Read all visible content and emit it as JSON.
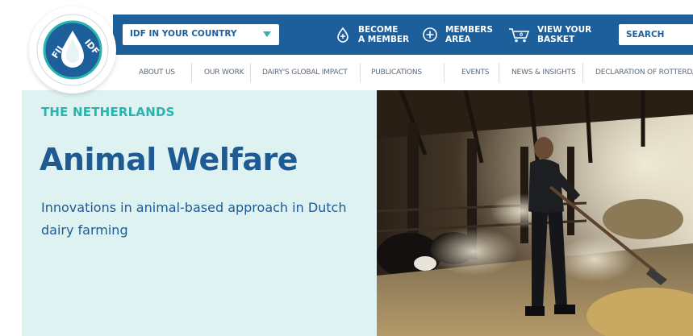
{
  "header": {
    "country_select": {
      "label": "IDF IN YOUR COUNTRY"
    },
    "actions": [
      {
        "label_line1": "BECOME",
        "label_line2": "A MEMBER",
        "icon": "membership-drop-icon"
      },
      {
        "label_line1": "MEMBERS",
        "label_line2": "AREA",
        "icon": "plus-circle-icon"
      },
      {
        "label_line1": "VIEW YOUR",
        "label_line2": "BASKET",
        "icon": "cart-icon"
      }
    ],
    "search": {
      "placeholder": "SEARCH"
    }
  },
  "nav": {
    "items": [
      {
        "label": "ABOUT US"
      },
      {
        "label": "OUR WORK"
      },
      {
        "label": "DAIRY'S GLOBAL IMPACT"
      },
      {
        "label": "PUBLICATIONS"
      },
      {
        "label": "EVENTS"
      },
      {
        "label": "NEWS & INSIGHTS"
      },
      {
        "label": "DECLARATION OF ROTTERDAM"
      }
    ]
  },
  "logo": {
    "text_left": "FIL",
    "text_right": "IDF"
  },
  "hero": {
    "country": "THE NETHERLANDS",
    "title": "Animal Welfare",
    "subtitle": "Innovations in animal-based approach in Dutch dairy farming"
  },
  "colors": {
    "brand_blue": "#1d5f9b",
    "accent_teal": "#2bb3ad",
    "hero_bg": "#dff2f2"
  }
}
